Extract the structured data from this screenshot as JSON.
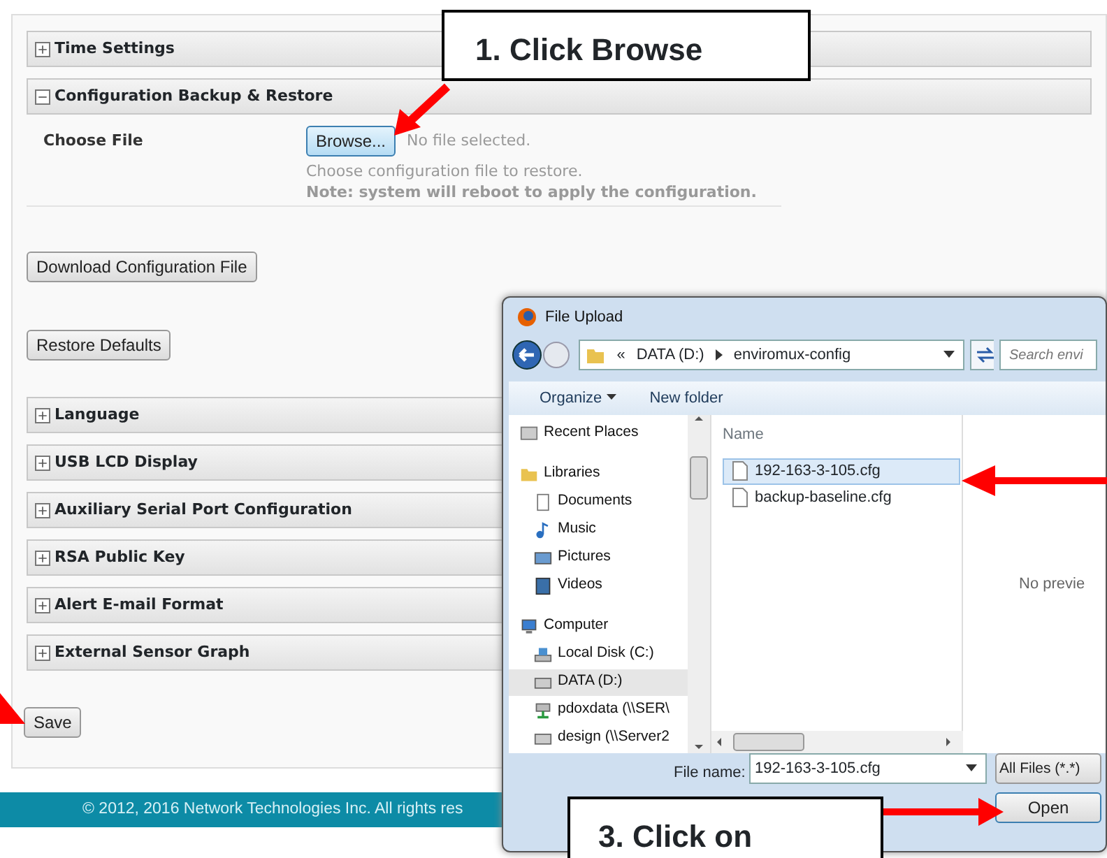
{
  "sections_top": [
    {
      "title": "Time Settings",
      "expanded": false
    },
    {
      "title": "Configuration Backup & Restore",
      "expanded": true
    }
  ],
  "restore_form": {
    "label": "Choose File",
    "browse_button": "Browse...",
    "file_status": "No file selected.",
    "hint": "Choose configuration file to restore.",
    "note": "Note: system will reboot to apply the configuration."
  },
  "download_button": "Download Configuration File",
  "restore_defaults_button": "Restore Defaults",
  "sections_bottom": [
    {
      "title": "Language",
      "expanded": false
    },
    {
      "title": "USB LCD Display",
      "expanded": false
    },
    {
      "title": "Auxiliary Serial Port Configuration",
      "expanded": false
    },
    {
      "title": "RSA Public Key",
      "expanded": false
    },
    {
      "title": "Alert E-mail Format",
      "expanded": false
    },
    {
      "title": "External Sensor Graph",
      "expanded": false
    }
  ],
  "save_button": "Save",
  "footer": "© 2012, 2016 Network Technologies Inc. All rights res",
  "dialog": {
    "title": "File Upload",
    "path": [
      "«",
      "DATA (D:)",
      "enviromux-config"
    ],
    "search": {
      "placeholder": "Search envi"
    },
    "toolbar": [
      "Organize",
      "New folder"
    ],
    "nav": [
      {
        "label": "Recent Places",
        "kind": "recent",
        "selected": false
      },
      {
        "label": "Libraries",
        "kind": "library",
        "selected": false,
        "children": [
          {
            "label": "Documents",
            "kind": "documents",
            "selected": false
          },
          {
            "label": "Music",
            "kind": "music",
            "selected": false
          },
          {
            "label": "Pictures",
            "kind": "pictures",
            "selected": false
          },
          {
            "label": "Videos",
            "kind": "videos",
            "selected": false
          }
        ]
      },
      {
        "label": "Computer",
        "kind": "computer",
        "selected": false,
        "children": [
          {
            "label": "Local Disk (C:)",
            "kind": "disk",
            "selected": false
          },
          {
            "label": "DATA (D:)",
            "kind": "drive",
            "selected": true
          },
          {
            "label": "pdoxdata (\\\\SER\\",
            "kind": "network",
            "selected": false
          },
          {
            "label": "design (\\\\Server2",
            "kind": "drive",
            "selected": false
          }
        ]
      }
    ],
    "column_header": "Name",
    "files": [
      {
        "name": "192-163-3-105.cfg",
        "selected": true
      },
      {
        "name": "backup-baseline.cfg",
        "selected": false
      }
    ],
    "preview": "No previe",
    "file_name_label": "File name:",
    "file_name_value": "192-163-3-105.cfg",
    "filter": "All Files (*.*)",
    "open_button": "Open"
  },
  "callouts": [
    "1. Click Browse",
    "3. Click on"
  ]
}
